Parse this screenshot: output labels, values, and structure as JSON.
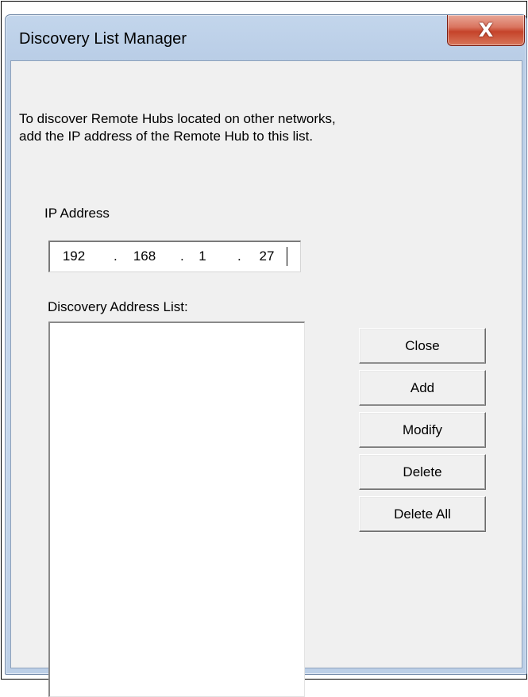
{
  "window": {
    "title": "Discovery List Manager",
    "close_glyph": "X",
    "close_icon": "close-icon"
  },
  "intro": {
    "line1": "To discover Remote Hubs located on other networks,",
    "line2": "add the IP address of the Remote Hub to this list."
  },
  "ip_address": {
    "label": "IP Address",
    "octets": [
      "192",
      "168",
      "1",
      "27"
    ],
    "separator": "."
  },
  "discovery_list": {
    "label": "Discovery Address List:",
    "items": []
  },
  "buttons": {
    "close": "Close",
    "add": "Add",
    "modify": "Modify",
    "delete": "Delete",
    "delete_all": "Delete All"
  },
  "colors": {
    "close_button_red": "#c5432a",
    "frame_blue": "#c3d6ec",
    "client_gray": "#f0f0f0"
  }
}
